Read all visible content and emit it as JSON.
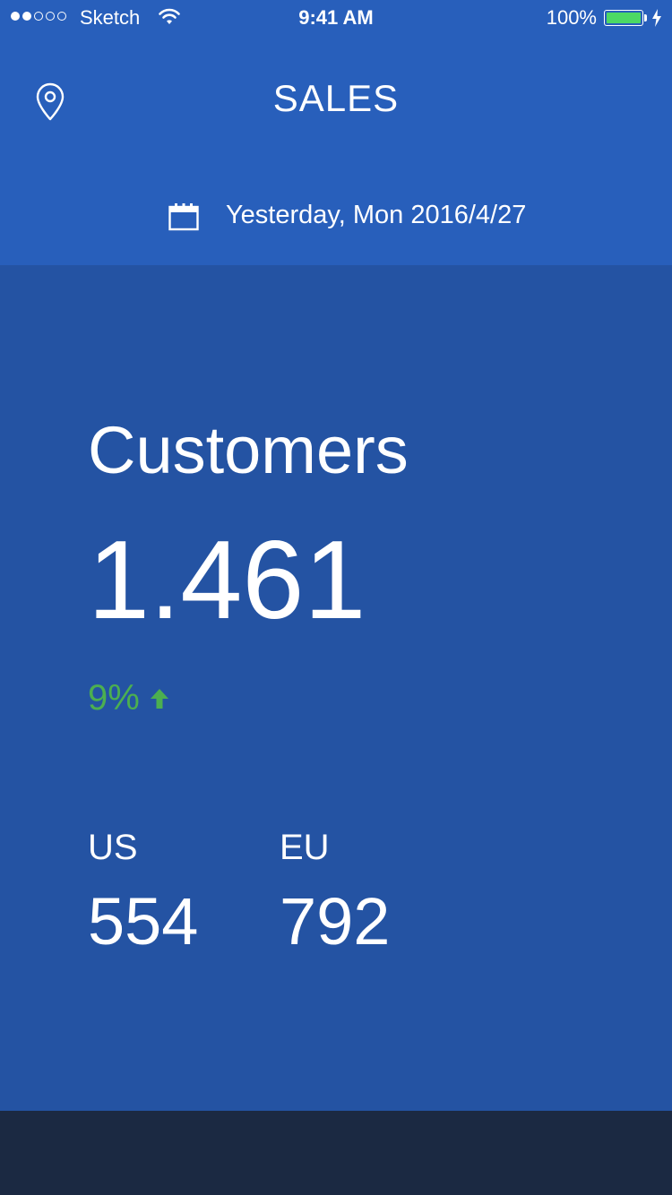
{
  "status_bar": {
    "signal_filled": 2,
    "signal_total": 5,
    "carrier": "Sketch",
    "time": "9:41 AM",
    "battery_percent": "100%",
    "battery_color": "#4cd964"
  },
  "header": {
    "title": "SALES",
    "date": "Yesterday, Mon 2016/4/27",
    "location_icon": "location-pin-icon",
    "calendar_icon": "calendar-icon"
  },
  "metric": {
    "label": "Customers",
    "value": "1.461",
    "change": "9%",
    "change_direction": "up",
    "change_color": "#4caf50"
  },
  "regions": [
    {
      "label": "US",
      "value": "554"
    },
    {
      "label": "EU",
      "value": "792"
    }
  ],
  "colors": {
    "header_bg": "#285fbb",
    "card_bg": "#2453a3",
    "bottom_bg": "#1b2942"
  }
}
